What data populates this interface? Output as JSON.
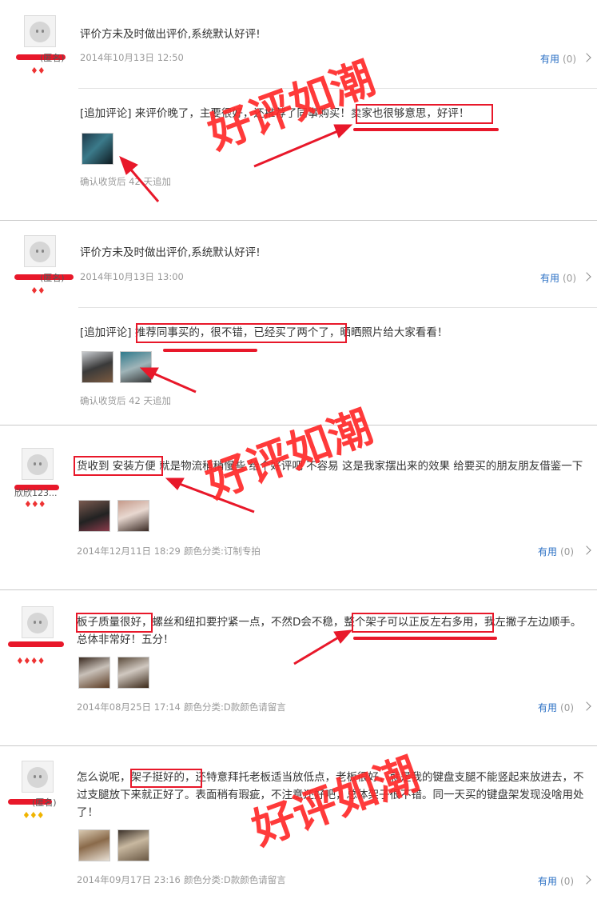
{
  "watermark": "好评如潮",
  "useful_label": "有用",
  "useful_count": "(0)",
  "reviews": [
    {
      "username": "(匿名)",
      "hearts": "♦♦",
      "text": "评价方未及时做出评价,系统默认好评!",
      "date": "2014年10月13日 12:50",
      "followup": {
        "prefix": "[追加评论]",
        "text_a": " 来评价晚了，主要很好，还推荐了同事购买！",
        "highlight": "卖家也很够意思，好评！",
        "note": "确认收货后 42 天追加"
      }
    },
    {
      "username": "(匿名)",
      "hearts": "♦♦",
      "text": "评价方未及时做出评价,系统默认好评!",
      "date": "2014年10月13日 13:00",
      "followup": {
        "prefix": "[追加评论]",
        "highlight": "推荐同事买的，很不错，已经买了两个了，",
        "text_b": "晒晒照片给大家看看！",
        "note": "确认收货后 42 天追加"
      }
    },
    {
      "username": "欣欣123...",
      "hearts": "♦♦♦",
      "highlight": "货收到 安装方便",
      "text": " 就是物流稍稍慢些 给个好评吧 不容易 这是我家摆出来的效果 给要买的朋友朋友借鉴一下",
      "date": "2014年12月11日 18:29",
      "variant": "颜色分类:订制专拍"
    },
    {
      "username": "",
      "hearts": "♦♦♦♦",
      "highlight_a": "板子质量很好，",
      "text_a": "螺丝和纽扣要拧紧一点，不然D会不稳，",
      "highlight_b": "整个架子可以正反左右多用，",
      "text_b": "我左撇子左边顺手。总体非常好！五分！",
      "date": "2014年08月25日 17:14",
      "variant": "颜色分类:D款颜色请留言"
    },
    {
      "username": "(匿名)",
      "hearts": "♦♦♦",
      "text_a": "怎么说呢，",
      "highlight": "架子挺好的，",
      "text_b": "还特意拜托老板适当放低点，老板很好，就是我的键盘支腿不能竖起来放进去，不过支腿放下来就正好了。表面稍有瑕疵，不注意还好吧，总体架子很不错。同一天买的键盘架发现没啥用处了！",
      "date": "2014年09月17日 23:16",
      "variant": "颜色分类:D款颜色请留言"
    }
  ]
}
